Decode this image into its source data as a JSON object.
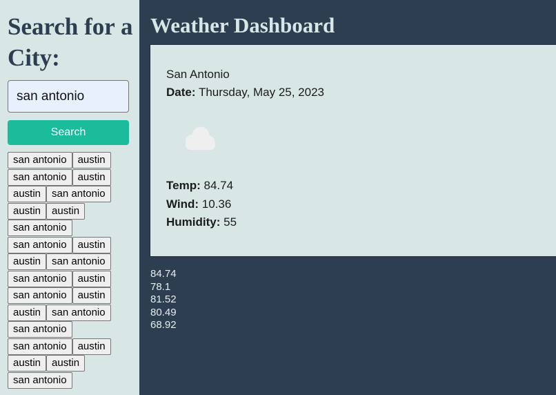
{
  "sidebar": {
    "heading": "Search for a City:",
    "search_value": "san antonio",
    "search_button_label": "Search",
    "history": [
      "san antonio",
      "austin",
      "san antonio",
      "austin",
      "austin",
      "san antonio",
      "austin",
      "austin",
      "san antonio",
      "san antonio",
      "austin",
      "austin",
      "san antonio",
      "san antonio",
      "austin",
      "san antonio",
      "austin",
      "austin",
      "san antonio",
      "san antonio",
      "san antonio",
      "austin",
      "austin",
      "austin",
      "san antonio"
    ]
  },
  "main": {
    "title": "Weather Dashboard",
    "current": {
      "city": "San Antonio",
      "date_label": "Date:",
      "date_value": "Thursday, May 25, 2023",
      "icon": "cloud-icon",
      "temp_label": "Temp:",
      "temp_value": "84.74",
      "wind_label": "Wind:",
      "wind_value": "10.36",
      "humidity_label": "Humidity:",
      "humidity_value": "55"
    },
    "forecast_temps": [
      "84.74",
      "78.1",
      "81.52",
      "80.49",
      "68.92"
    ]
  }
}
